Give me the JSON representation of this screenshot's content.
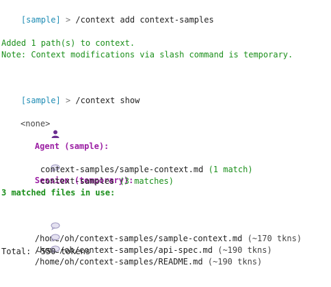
{
  "prompt": {
    "tag": "[sample]",
    "arrow": ">"
  },
  "lines": {
    "cmd1": "/context add context-samples",
    "added": "Added 1 path(s) to context.",
    "note": "Note: Context modifications via slash command is temporary.",
    "cmd2": "/context show",
    "agent_header": "Agent (sample):",
    "agent_value": "<none>",
    "session_header": "Session (temporary):",
    "session_item1_name": "context-samples/sample-context.md",
    "session_item1_count": "(1 match)",
    "session_item2_name": "context-samples",
    "session_item2_count": "(3 matches)",
    "matched_header": "3 matched files in use:",
    "file1_path": "/home/oh/context-samples/sample-context.md",
    "file1_tokens": "(~170 tkns)",
    "file2_path": "/home/oh/context-samples/api-spec.md",
    "file2_tokens": "(~190 tkns)",
    "file3_path": "/home/oh/context-samples/README.md",
    "file3_tokens": "(~190 tkns)",
    "total": "Total: ~550 tokens"
  },
  "icons": {
    "agent": "person-icon",
    "session": "speech-bubble-icon",
    "file": "speech-bubble-icon"
  },
  "colors": {
    "prompt": "#1e8cb4",
    "success": "#1b8f1b",
    "header": "#9b1ea3"
  }
}
